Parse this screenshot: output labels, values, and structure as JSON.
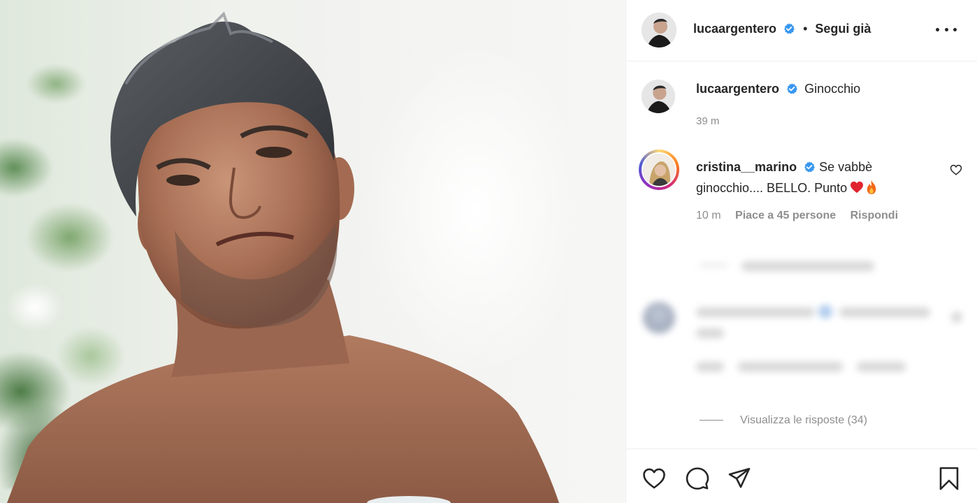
{
  "post": {
    "author": {
      "username": "lucaargentero",
      "verified": true,
      "follow_status": "Segui già",
      "separator": "•"
    },
    "caption": {
      "username": "lucaargentero",
      "text": "Ginocchio",
      "time": "39 m"
    },
    "comments": [
      {
        "username": "cristina__marino",
        "verified": true,
        "text": "Se vabbè ginocchio.... BELLO. Punto",
        "emojis": [
          "red-heart-emoji",
          "fire-emoji"
        ],
        "time": "10 m",
        "likes": "Piace a 45 persone",
        "reply_label": "Rispondi"
      }
    ],
    "view_replies": "Visualizza le risposte (34)"
  },
  "icons": {
    "more": "more-options-icon",
    "verified": "verified-badge-icon",
    "like": "heart-icon",
    "comment": "comment-icon",
    "share": "send-icon",
    "save": "bookmark-icon"
  },
  "colors": {
    "text": "#262626",
    "muted": "#8e8e8e",
    "verified": "#3897f0",
    "border": "#efefef"
  }
}
